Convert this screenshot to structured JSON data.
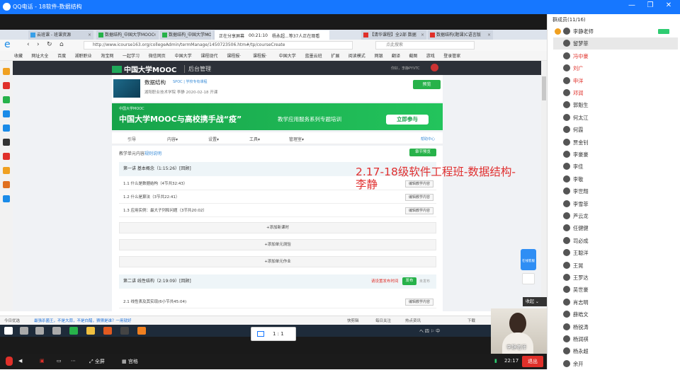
{
  "qq": {
    "title": "QQ电话 - 18软件-数据结构",
    "members_header": "群成员(11/16)",
    "controls": {
      "minimize": "—",
      "restore": "❐",
      "close": "✕"
    }
  },
  "share": {
    "status": "正在分享屏幕",
    "time": "00:21:10",
    "viewers": "杨永超...等37人正在观看"
  },
  "browser": {
    "tabs": [
      {
        "label": "云班课 - 班课资源",
        "color": "#3aa0e8"
      },
      {
        "label": "数据结构_中国大学MOOC",
        "color": "#27b24a"
      },
      {
        "label": "数据结构_中国大学MO",
        "color": "#27b24a"
      },
      {
        "label": "MOOC",
        "color": "#27b24a"
      },
      {
        "label": "【清华课程】全2部 数据",
        "color": "#e0302a"
      },
      {
        "label": "数据结构(题课)C语言版",
        "color": "#e0302a"
      }
    ],
    "url": "http://www.icourse163.org/collegeAdmin/termManage/1450723506.htm#/tp/courseCreate",
    "search_placeholder": "点此搜索",
    "bookmarks": [
      "收藏",
      "网址大全",
      "百度",
      "湖职职业",
      "淘宝网",
      "一起学习",
      "微信网页",
      "中国大学",
      "课程现代",
      "课程报·",
      "课程报·",
      "中国大学",
      "蓝墨云班",
      "扩展",
      "阅读模式",
      "网银",
      "翻译",
      "截图",
      "游戏",
      "登录管家"
    ],
    "status_left": "今日优选",
    "status_news": "最强杀菌王，不是大蒜，不是白醋，猜猜是谁？一用就好",
    "status_right": [
      "快剪辑",
      "每日关注",
      "热点资讯",
      "下载"
    ]
  },
  "mooc": {
    "logo": "中国大学MOOC",
    "admin_label": "后台管理",
    "user_text": "你好，李静PYVTC",
    "course_name": "数据结构",
    "course_tag": "SPOC | 学校专有课程",
    "course_meta": "湖阳职业技术学院   李静     2020-02-18 开课",
    "publish_button": "预览",
    "banner_small": "中国大学MOOC",
    "banner_big": "中国大学MOOC与高校携手战“疫”",
    "banner_sub": "教学应用服务系列专题培训",
    "banner_button": "立即参与",
    "nav": [
      "引导",
      "内容▾",
      "设置▾",
      "工具▾",
      "管理室▾"
    ],
    "help": "帮助中心",
    "unit_title": "教学单元内容",
    "unit_link": "规则说明",
    "chapter_button": "章节预览",
    "chapter1": "第一讲 基本概念（1:15:26）[回顾]",
    "lessons": [
      "1.1 什么是数据结构（4节共32:43）",
      "1.2 什么是算法（3节共22:41）",
      "1.3 应用实例：最大子列和问题（3节共20:02）"
    ],
    "edit_label": "编辑教学内容",
    "add_lesson": "+添加新课时",
    "add_quiz": "+添加单元测验",
    "add_homework": "+添加单元作业",
    "chapter2": "第二讲 线性结构（2:19:09）[回顾]",
    "chapter2_warn": "请设置发布时间",
    "chapter2_publish": "发布",
    "chapter2_unpub": "未发布",
    "lesson21": "2.1 线性表及其实现(6小节共45:04)",
    "annotation": "2.17-18级软件工程班-数据结构-李静",
    "side_tool_label": "在线客服",
    "collapse": "收起"
  },
  "taskbar": {
    "zoom": "1 : 1",
    "right": "へ 四 ⚐ 中"
  },
  "webcam": {
    "label": "李静老师"
  },
  "bottom": {
    "fullscreen": "全屏",
    "grid": "宫格",
    "time": "22:17",
    "exit": "退出"
  },
  "members": [
    {
      "name": "李静老师",
      "color": "#333",
      "role": true,
      "status": true
    },
    {
      "name": "留梦菲",
      "color": "#333",
      "selected": true
    },
    {
      "name": "冯中豪",
      "color": "#e0302a"
    },
    {
      "name": "刘广",
      "color": "#e0302a"
    },
    {
      "name": "申洋",
      "color": "#e0302a"
    },
    {
      "name": "邓润",
      "color": "#e0302a"
    },
    {
      "name": "郭魁生",
      "color": "#333"
    },
    {
      "name": "何太江",
      "color": "#333"
    },
    {
      "name": "何霞",
      "color": "#333"
    },
    {
      "name": "贾金钊",
      "color": "#333"
    },
    {
      "name": "李豪豪",
      "color": "#333"
    },
    {
      "name": "李佳",
      "color": "#333"
    },
    {
      "name": "李敬",
      "color": "#333"
    },
    {
      "name": "李世翔",
      "color": "#333"
    },
    {
      "name": "李雪菲",
      "color": "#333"
    },
    {
      "name": "芦云龙",
      "color": "#333"
    },
    {
      "name": "任健健",
      "color": "#333"
    },
    {
      "name": "司必成",
      "color": "#333"
    },
    {
      "name": "王聪洋",
      "color": "#333"
    },
    {
      "name": "王晃",
      "color": "#333"
    },
    {
      "name": "王罗达",
      "color": "#333"
    },
    {
      "name": "吴世豪",
      "color": "#333"
    },
    {
      "name": "肖志明",
      "color": "#333"
    },
    {
      "name": "薛皓文",
      "color": "#333"
    },
    {
      "name": "杨锐涛",
      "color": "#333"
    },
    {
      "name": "杨润祺",
      "color": "#333"
    },
    {
      "name": "杨永超",
      "color": "#333"
    },
    {
      "name": "余开",
      "color": "#333"
    }
  ]
}
